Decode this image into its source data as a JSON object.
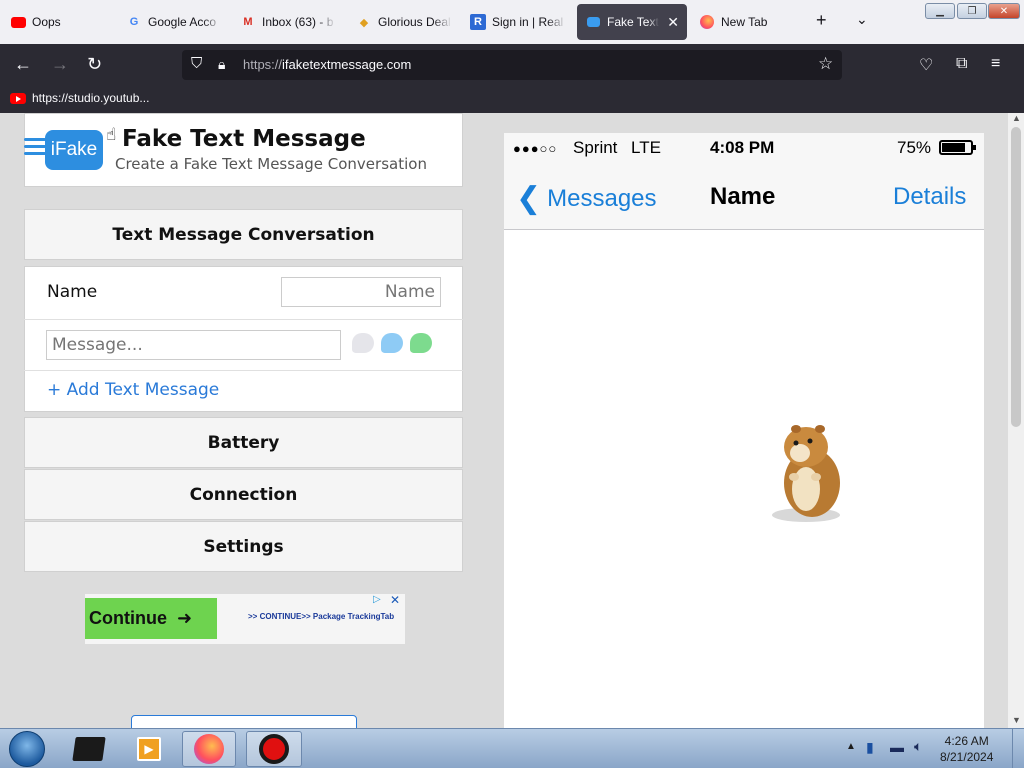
{
  "browser": {
    "tabs": [
      {
        "label": "Oops",
        "icon": "youtube-icon"
      },
      {
        "label": "Google Acco",
        "icon": "google-icon"
      },
      {
        "label": "Inbox (63) - b",
        "icon": "gmail-icon"
      },
      {
        "label": "Glorious Deal",
        "icon": "deal-icon"
      },
      {
        "label": "Sign in | Real",
        "icon": "signin-icon"
      },
      {
        "label": "Fake Text M",
        "icon": "message-icon",
        "active": true
      },
      {
        "label": "New Tab",
        "icon": "firefox-icon"
      }
    ],
    "url_scheme": "https://",
    "url_host": "ifaketextmessage.com",
    "bookmark": "https://studio.youtub..."
  },
  "site": {
    "logo_text": "iFake",
    "title": "Fake Text Message",
    "subtitle": "Create a Fake Text Message Conversation",
    "section_conversation": "Text Message Conversation",
    "name_label": "Name",
    "name_placeholder": "Name",
    "message_placeholder": "Message...",
    "add_message": "+ Add Text Message",
    "section_battery": "Battery",
    "section_connection": "Connection",
    "section_settings": "Settings",
    "ad_button": "Continue",
    "ad_text": ">> CONTINUE>> Package TrackingTab"
  },
  "phone": {
    "carrier": "Sprint",
    "network": "LTE",
    "time": "4:08 PM",
    "battery": "75%",
    "back_label": "Messages",
    "contact_name": "Name",
    "details_label": "Details"
  },
  "taskbar": {
    "time": "4:26 AM",
    "date": "8/21/2024"
  },
  "colors": {
    "accent_blue": "#1a7fd8",
    "bubble_gray": "#e5e5ea",
    "bubble_blue": "#8ecbf5",
    "bubble_green": "#7ddb8e",
    "ad_green": "#6ed34f"
  }
}
